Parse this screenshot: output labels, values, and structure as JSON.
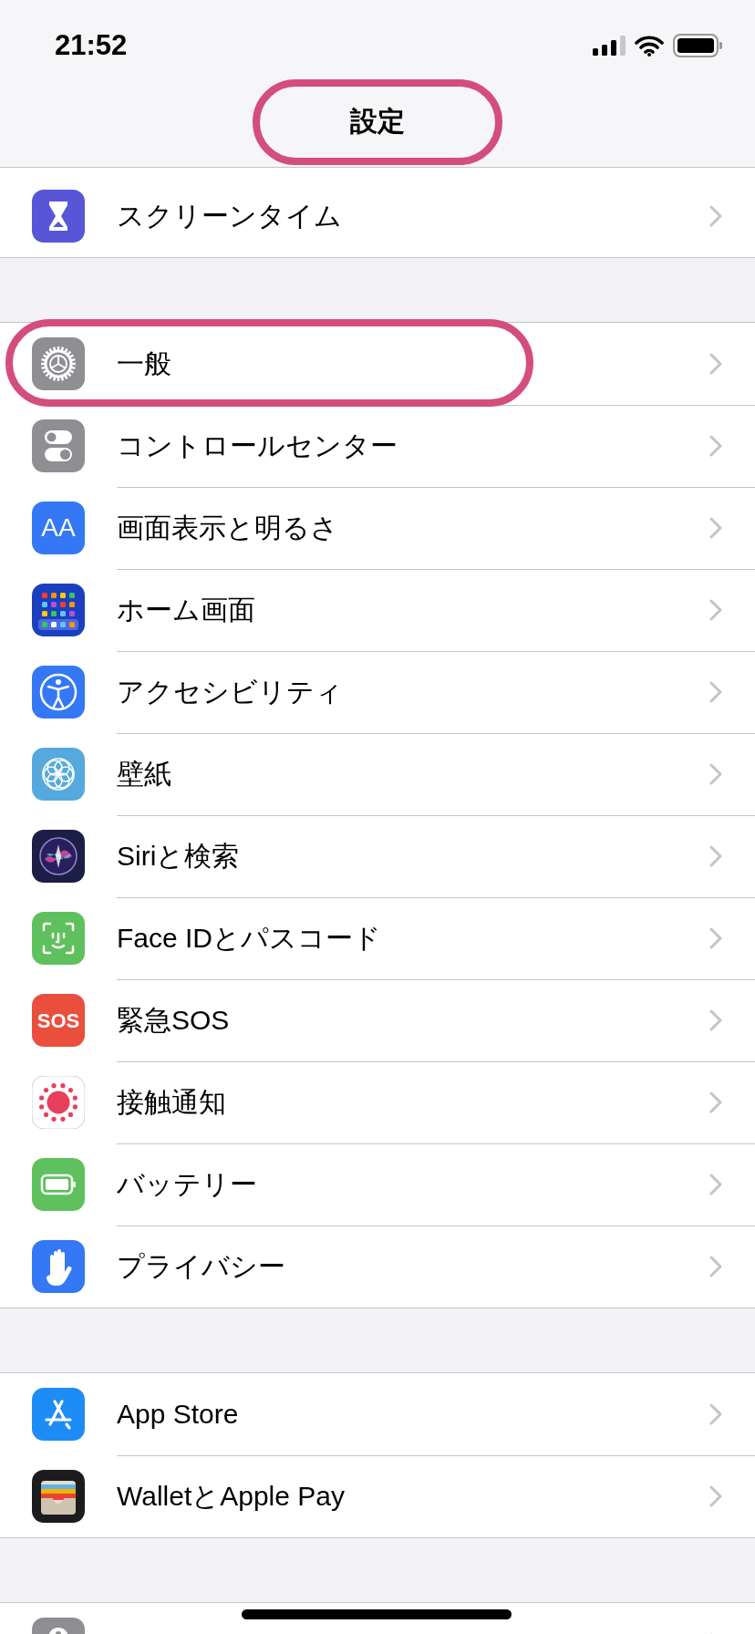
{
  "status_bar": {
    "time": "21:52"
  },
  "nav": {
    "title": "設定",
    "highlighted": true
  },
  "groups": [
    {
      "rows": [
        {
          "label": "スクリーンタイム",
          "highlighted": false
        }
      ]
    },
    {
      "rows": [
        {
          "label": "一般",
          "highlighted": true
        },
        {
          "label": "コントロールセンター",
          "highlighted": false
        },
        {
          "label": "画面表示と明るさ",
          "highlighted": false,
          "icon_text": "AA"
        },
        {
          "label": "ホーム画面",
          "highlighted": false
        },
        {
          "label": "アクセシビリティ",
          "highlighted": false
        },
        {
          "label": "壁紙",
          "highlighted": false
        },
        {
          "label": "Siriと検索",
          "highlighted": false
        },
        {
          "label": "Face IDとパスコード",
          "highlighted": false
        },
        {
          "label": "緊急SOS",
          "highlighted": false,
          "icon_text": "SOS"
        },
        {
          "label": "接触通知",
          "highlighted": false
        },
        {
          "label": "バッテリー",
          "highlighted": false
        },
        {
          "label": "プライバシー",
          "highlighted": false
        }
      ]
    },
    {
      "rows": [
        {
          "label": "App Store",
          "highlighted": false
        },
        {
          "label": "WalletとApple Pay",
          "highlighted": false
        }
      ]
    },
    {
      "rows": [
        {
          "highlighted": false
        }
      ]
    }
  ]
}
